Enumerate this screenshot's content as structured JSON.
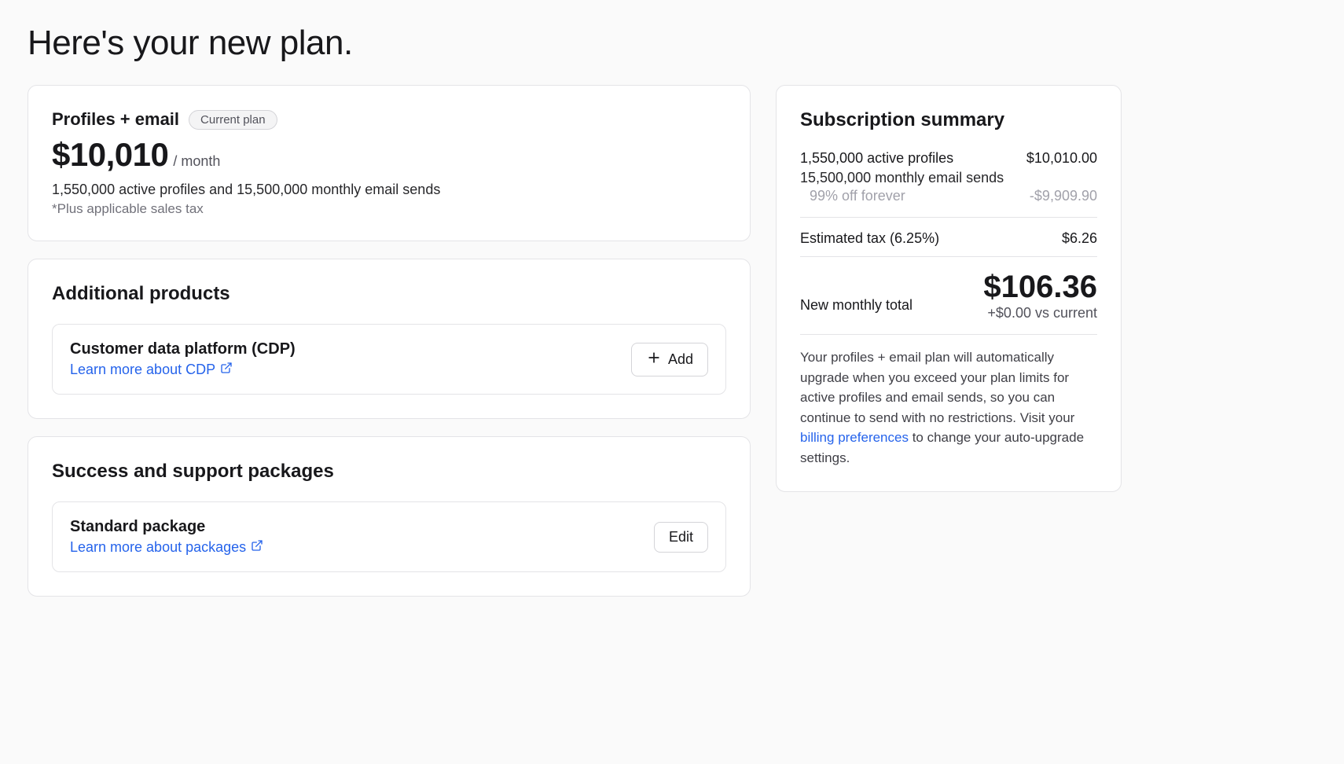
{
  "page": {
    "title": "Here's your new plan."
  },
  "plan": {
    "name": "Profiles + email",
    "badge": "Current plan",
    "price": "$10,010",
    "price_suffix": "/ month",
    "desc": "1,550,000 active profiles and 15,500,000 monthly email sends",
    "note": "*Plus applicable sales tax"
  },
  "additional_products": {
    "title": "Additional products",
    "item": {
      "title": "Customer data platform (CDP)",
      "link": "Learn more about CDP",
      "button": "Add"
    }
  },
  "support_packages": {
    "title": "Success and support packages",
    "item": {
      "title": "Standard package",
      "link": "Learn more about packages",
      "button": "Edit"
    }
  },
  "summary": {
    "title": "Subscription summary",
    "line1": "1,550,000 active profiles",
    "line1_amount": "$10,010.00",
    "line2": "15,500,000 monthly email sends",
    "discount_label": "99% off forever",
    "discount_amount": "-$9,909.90",
    "tax_label": "Estimated tax (6.25%)",
    "tax_amount": "$6.26",
    "total_label": "New monthly total",
    "total_amount": "$106.36",
    "total_delta": "+$0.00 vs current",
    "footer_pre": "Your profiles + email plan will automatically upgrade when you exceed your plan limits for active profiles and email sends, so you can continue to send with no restrictions. Visit your ",
    "footer_link": "billing preferences",
    "footer_post": " to change your auto-upgrade settings."
  }
}
